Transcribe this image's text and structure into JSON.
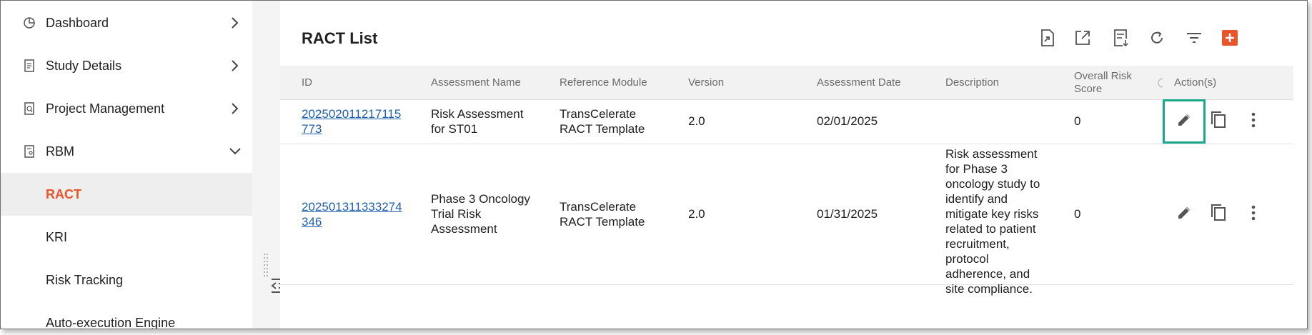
{
  "sidebar": {
    "items": [
      {
        "label": "Dashboard",
        "icon": "pie-chart-icon",
        "chevron": "right"
      },
      {
        "label": "Study Details",
        "icon": "document-icon",
        "chevron": "right"
      },
      {
        "label": "Project Management",
        "icon": "document-search-icon",
        "chevron": "right"
      },
      {
        "label": "RBM",
        "icon": "document-person-icon",
        "chevron": "down"
      }
    ],
    "subitems": [
      {
        "label": "RACT",
        "active": true
      },
      {
        "label": "KRI",
        "active": false
      },
      {
        "label": "Risk Tracking",
        "active": false
      },
      {
        "label": "Auto-execution Engine",
        "active": false
      }
    ]
  },
  "panel": {
    "title": "RACT List",
    "toolbar": [
      "import-icon",
      "export-icon",
      "download-report-icon",
      "refresh-icon",
      "filter-icon",
      "add-icon"
    ]
  },
  "table": {
    "headers": {
      "id": "ID",
      "name": "Assessment Name",
      "module": "Reference Module",
      "version": "Version",
      "date": "Assessment Date",
      "description": "Description",
      "score_line1": "Overall Risk",
      "score_line2": "Score",
      "actions": "Action(s)"
    },
    "rows": [
      {
        "id_line1": "202502011217115",
        "id_line2": "773",
        "name_lines": [
          "Risk Assessment",
          "for ST01"
        ],
        "module_lines": [
          "TransCelerate",
          "RACT Template"
        ],
        "version": "2.0",
        "date": "02/01/2025",
        "description_lines": [],
        "score": "0"
      },
      {
        "id_line1": "202501311333274",
        "id_line2": "346",
        "name_lines": [
          "Phase 3 Oncology",
          "Trial Risk",
          "Assessment"
        ],
        "module_lines": [
          "TransCelerate",
          "RACT Template"
        ],
        "version": "2.0",
        "date": "01/31/2025",
        "description_lines": [
          "Risk assessment",
          "for Phase 3",
          "oncology study to",
          "identify and",
          "mitigate key risks",
          "related to patient",
          "recruitment,",
          "protocol",
          "adherence, and",
          "site compliance."
        ],
        "score": "0"
      }
    ]
  },
  "colors": {
    "accent": "#e8552a",
    "link": "#1f5fae",
    "focus": "#19a98a",
    "active_bg": "#eeeeee"
  }
}
